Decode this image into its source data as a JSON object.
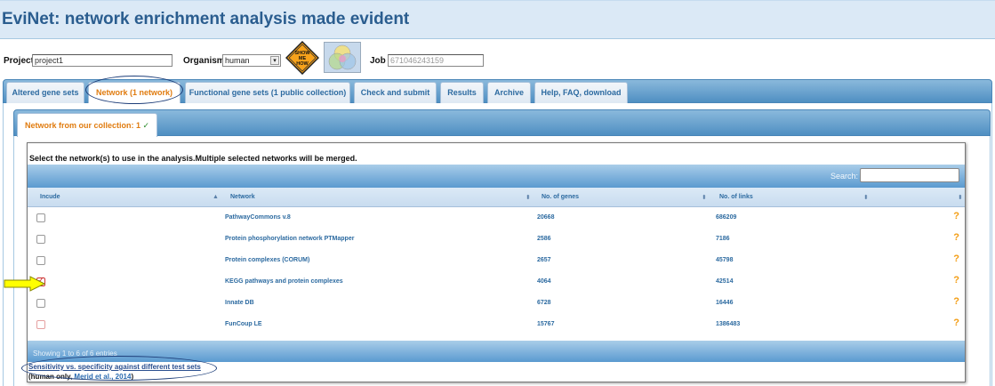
{
  "app": {
    "title": "EviNet: network enrichment analysis made evident"
  },
  "project": {
    "label": "Project",
    "value": "project1"
  },
  "organism": {
    "label": "Organism",
    "value": "human"
  },
  "show_me_how": {
    "lines": [
      "SHOW",
      "ME",
      "HOW"
    ]
  },
  "job": {
    "label": "Job",
    "value": "671046243159"
  },
  "tabs": [
    {
      "label": "Altered gene sets",
      "active": false
    },
    {
      "label": "Network (1 network)",
      "active": true
    },
    {
      "label": "Functional gene sets (1 public collection)",
      "active": false
    },
    {
      "label": "Check and submit",
      "active": false
    },
    {
      "label": "Results",
      "active": false
    },
    {
      "label": "Archive",
      "active": false
    },
    {
      "label": "Help, FAQ, download",
      "active": false
    }
  ],
  "subtab": {
    "label": "Network from our collection: 1",
    "check": "✓"
  },
  "instruction": "Select the network(s) to use in the analysis.Multiple selected networks will be merged.",
  "search": {
    "label": "Search:",
    "value": ""
  },
  "table": {
    "headers": [
      "Incude",
      "Network",
      "No. of genes",
      "No. of links"
    ],
    "rows": [
      {
        "checked": false,
        "network": "PathwayCommons v.8",
        "genes": "20668",
        "links": "686209",
        "help": "?"
      },
      {
        "checked": false,
        "network": "Protein phosphorylation network PTMapper",
        "genes": "2586",
        "links": "7186",
        "help": "?"
      },
      {
        "checked": false,
        "network": "Protein complexes (CORUM)",
        "genes": "2657",
        "links": "45798",
        "help": "?"
      },
      {
        "checked": true,
        "network": "KEGG pathways and protein complexes",
        "genes": "4064",
        "links": "42514",
        "help": "?"
      },
      {
        "checked": false,
        "network": "Innate DB",
        "genes": "6728",
        "links": "16446",
        "help": "?"
      },
      {
        "checked": false,
        "network": "FunCoup LE",
        "genes": "15767",
        "links": "1386483",
        "help": "?"
      }
    ],
    "footer": "Showing 1 to 6 of 6 entries"
  },
  "footnote": {
    "link": "Sensitivity vs. specificity against different test sets",
    "prefix": "(human only, ",
    "ref": "Merid et al., 2014",
    "suffix": ")"
  },
  "colors": {
    "accent": "#e07c10",
    "link": "#2c6aa0",
    "help": "#f39c12",
    "arrow": "#ffff00"
  }
}
